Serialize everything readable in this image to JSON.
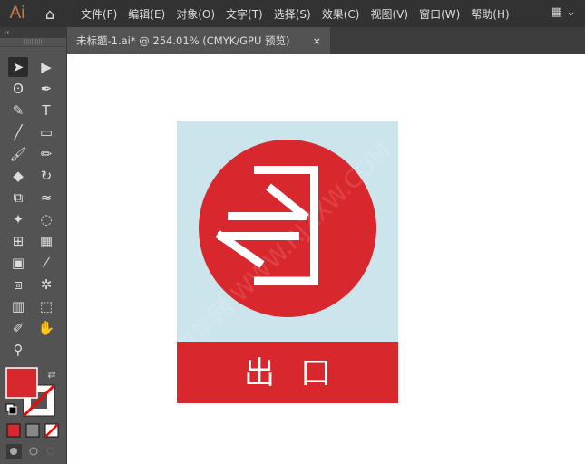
{
  "app": {
    "logo": "Ai"
  },
  "menu": [
    "文件(F)",
    "编辑(E)",
    "对象(O)",
    "文字(T)",
    "选择(S)",
    "效果(C)",
    "视图(V)",
    "窗口(W)",
    "帮助(H)"
  ],
  "tab": {
    "title": "未标题-1.ai* @ 254.01% (CMYK/GPU 预览)",
    "close": "×"
  },
  "toolbar": {
    "collapse": "‹‹"
  },
  "tools": [
    "selection",
    "direct-selection",
    "lasso",
    "pen",
    "curvature",
    "type",
    "line",
    "rectangle",
    "paintbrush",
    "pencil",
    "eraser",
    "rotate",
    "scale",
    "warp",
    "puppet-warp",
    "shape-builder",
    "mesh",
    "perspective-grid",
    "gradient",
    "eyedropper",
    "blend",
    "symbol-sprayer",
    "column-graph",
    "artboard",
    "slice",
    "hand",
    "zoom"
  ],
  "colors": {
    "fill": "#d9282d",
    "stroke": "none",
    "accent": "#d9282d",
    "background": "#cce5ec"
  },
  "artwork": {
    "label": "出 口",
    "char1": "出",
    "char2": "口",
    "watermark": "软件自学网 WWW.RJZXW.COM"
  }
}
